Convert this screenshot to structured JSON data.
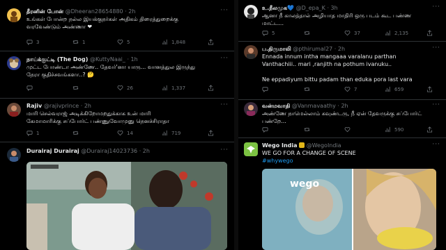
{
  "left_tweets": [
    {
      "name": "தீரனின் போன்",
      "handle": "@Dheeran28654880",
      "time": "2h",
      "text": "உங்கள் போன்ற நல்ல இயக்குநர்கள் அதிகம் திரைத்துறைக்கு\nவரவேண்டும் அண்ணா ❤",
      "replies": "3",
      "retweets": "1",
      "likes": "5",
      "views": "1,848"
    },
    {
      "name": "நாய்க்குட்டி (The Dog)",
      "handle": "@KuttyNaai_",
      "time": "1h",
      "text": "முட்ட போண்டா அண்ணே.. தேவர்'னா யாரு... வானத்துல இருந்து\nநேரா குதிச்சவங்களா..? 🤔",
      "replies": "",
      "retweets": "",
      "likes": "26",
      "views": "1,337"
    },
    {
      "name": "Rajiv",
      "handle": "@rajivprince",
      "time": "2h",
      "text": "மாரி செல்வராஜ் அடிக்கிறோமறதுக்காக உன் மாரி\nகேமாமாரிக்கு சப்போர்ட் பண்ணுவோமுனு நெனச்சிராதா",
      "replies": "1",
      "retweets": "",
      "likes": "14",
      "views": "719"
    },
    {
      "name": "Durairaj Durairaj",
      "handle": "@Durairaj14023736",
      "time": "2h",
      "text": ""
    }
  ],
  "right_tweets": [
    {
      "name": "உ.நீலமுக",
      "handle": "@D_epa_K",
      "time": "3h",
      "text": "ஆனா நீ காலத்தால் அழியாத மாதிரி ஒரு படம் கூட பண்ண\nமாட்ட...",
      "replies": "5",
      "retweets": "",
      "likes": "37",
      "views": "2,135"
    },
    {
      "name": "ப.திருமாலி",
      "handle": "@pthirumal27",
      "time": "2h",
      "text": "Ennada innum intha mangaaa varalanu parthan\nVanthachiii.. mari ,ranjith na pothum ivanuku..\n\nNe eppadiyum bittu padam than eduka pora last vara",
      "replies": "",
      "retweets": "",
      "likes": "7",
      "views": "659"
    },
    {
      "name": "வன்மவாதி",
      "handle": "@Vanmavaathy",
      "time": "2h",
      "text": "அண்ணே நாமெல்லாம் கவுண்டரு, நீ ஏன் தேவருக்கு சப்போர்ட்\nபண்றே...",
      "replies": "",
      "retweets": "",
      "likes": "",
      "views": "590"
    },
    {
      "name": "Wego India",
      "handle": "@WegoIndia",
      "time": "",
      "text": "WE GO FOR A CHANGE OF SCENE",
      "hashtag": "#whywego",
      "media_brand": "wego"
    }
  ],
  "colors": {
    "background": "#000000",
    "text": "#e7e9ea",
    "muted": "#71767b",
    "link": "#1d9bf0",
    "verified_gold": "#e2b719"
  }
}
